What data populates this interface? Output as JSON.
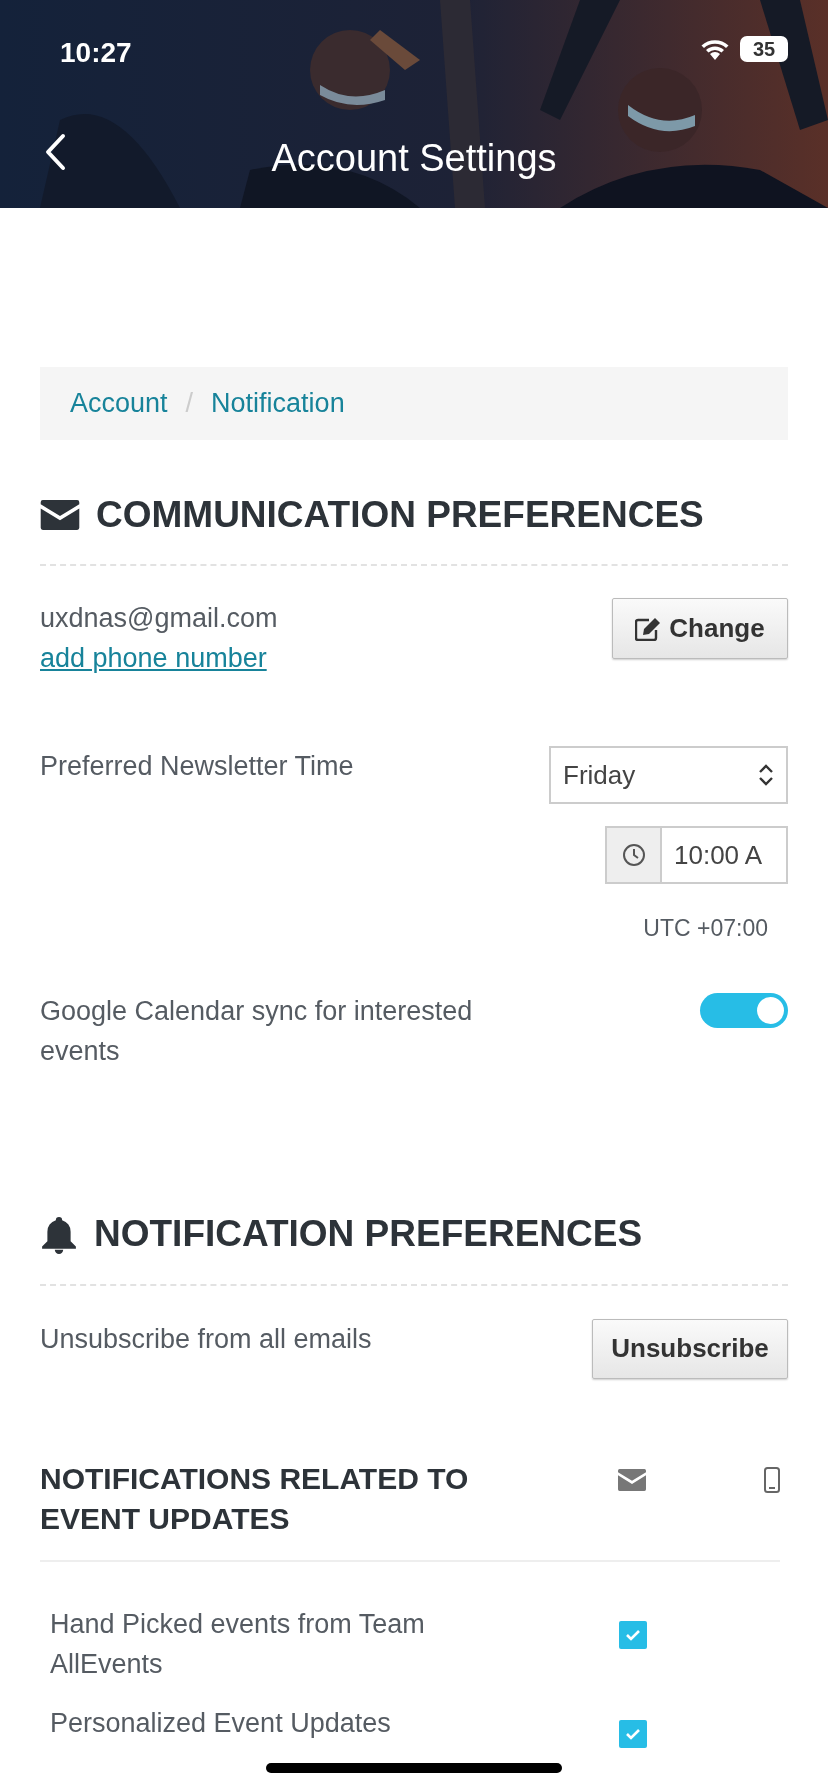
{
  "status_bar": {
    "time": "10:27",
    "battery": "35"
  },
  "header": {
    "title": "Account Settings",
    "kind": "picture"
  },
  "breadcrumb": {
    "separator": "/",
    "items": [
      {
        "label": "Account"
      },
      {
        "label": "Notification"
      }
    ]
  },
  "communication": {
    "title": "COMMUNICATION PREFERENCES",
    "email": "uxdnas@gmail.com",
    "phone_link": "add phone number",
    "change_button": "Change",
    "newsletter_label": "Preferred Newsletter Time",
    "day_select": "Friday",
    "time_field": "10:00 A",
    "timezone": "UTC +07:00",
    "calendar_sync": {
      "label": "Google Calendar sync for interested events",
      "on": true
    }
  },
  "notification": {
    "title": "NOTIFICATION PREFERENCES",
    "unsubscribe_label": "Unsubscribe from all emails",
    "unsubscribe_button": "Unsubscribe",
    "group_title": "NOTIFICATIONS RELATED TO EVENT UPDATES",
    "rows": [
      {
        "label": "Hand Picked events from Team AllEvents",
        "email_checked": true
      },
      {
        "label": "Personalized Event Updates",
        "email_checked": true
      }
    ]
  }
}
